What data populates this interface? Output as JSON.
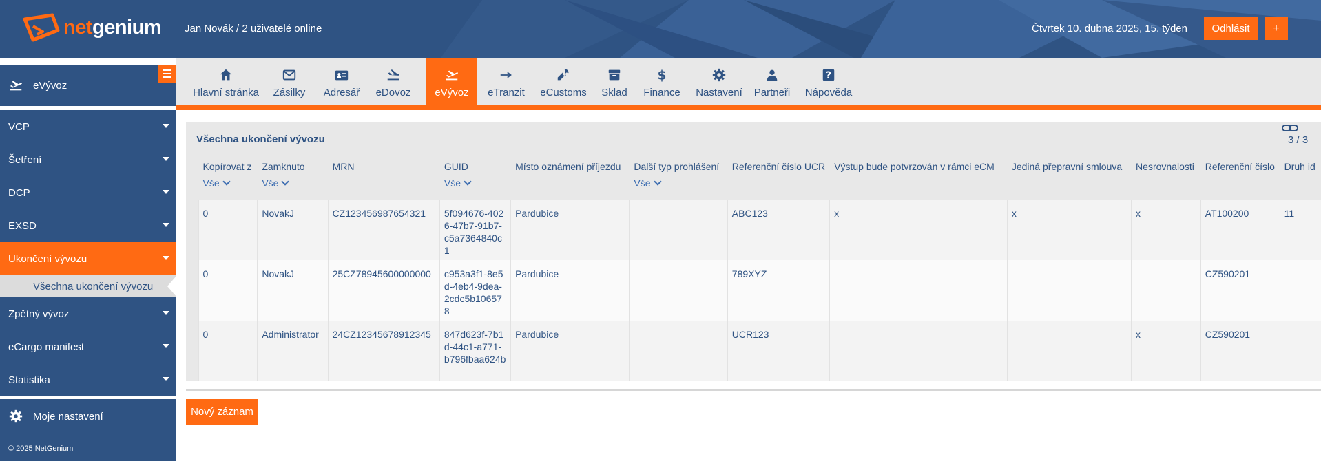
{
  "header": {
    "logo_text_a": "net",
    "logo_text_b": "genium",
    "user_info": "Jan Novák / 2 uživatelé online",
    "date_info": "Čtvrtek 10. dubna 2025, 15. týden",
    "logout_label": "Odhlásit",
    "plus_label": "+"
  },
  "nav": {
    "items": [
      {
        "label": "Hlavní stránka",
        "icon": "home-icon"
      },
      {
        "label": "Zásilky",
        "icon": "envelope-icon"
      },
      {
        "label": "Adresář",
        "icon": "id-card-icon"
      },
      {
        "label": "eDovoz",
        "icon": "plane-arrival-icon"
      },
      {
        "label": "eVývoz",
        "icon": "plane-departure-icon"
      },
      {
        "label": "eTranzit",
        "icon": "arrow-right-icon"
      },
      {
        "label": "eCustoms",
        "icon": "wrench-icon"
      },
      {
        "label": "Sklad",
        "icon": "archive-icon"
      },
      {
        "label": "Finance",
        "icon": "dollar-icon"
      },
      {
        "label": "Nastavení",
        "icon": "gear-icon"
      },
      {
        "label": "Partneři",
        "icon": "user-icon"
      },
      {
        "label": "Nápověda",
        "icon": "question-icon"
      }
    ],
    "active_index": 4
  },
  "sidebar": {
    "head_label": "eVývoz",
    "items": [
      {
        "label": "VCP"
      },
      {
        "label": "Šetření"
      },
      {
        "label": "DCP"
      },
      {
        "label": "EXSD"
      },
      {
        "label": "Ukončení vývozu"
      }
    ],
    "sub_item": "Všechna ukončení vývozu",
    "items_after": [
      {
        "label": "Zpětný vývoz"
      },
      {
        "label": "eCargo manifest"
      },
      {
        "label": "Statistika"
      }
    ],
    "settings_label": "Moje nastavení",
    "footer": "© 2025 NetGenium"
  },
  "panel": {
    "title": "Všechna ukončení vývozu",
    "count": "3 / 3"
  },
  "table": {
    "filter_label": "Vše",
    "columns": [
      {
        "label": "Kopírovat z",
        "filter": true
      },
      {
        "label": "Zamknuto",
        "filter": true
      },
      {
        "label": "MRN",
        "filter": false
      },
      {
        "label": "GUID",
        "filter": true
      },
      {
        "label": "Místo oznámení příjezdu",
        "filter": false
      },
      {
        "label": "Další typ prohlášení",
        "filter": true
      },
      {
        "label": "Referenční číslo UCR",
        "filter": false
      },
      {
        "label": "Výstup bude potvrzován v rámci eCM",
        "filter": false
      },
      {
        "label": "Jediná přepravní smlouva",
        "filter": false
      },
      {
        "label": "Nesrovnalosti",
        "filter": false
      },
      {
        "label": "Referenční číslo",
        "filter": false
      },
      {
        "label": "Druh id",
        "filter": false
      }
    ],
    "rows": [
      [
        "0",
        "NovakJ",
        "CZ123456987654321",
        "5f094676-4026-47b7-91b7-c5a7364840c1",
        "Pardubice",
        "",
        "ABC123",
        "x",
        "x",
        "x",
        "AT100200",
        "11"
      ],
      [
        "0",
        "NovakJ",
        "25CZ78945600000000",
        "c953a3f1-8e5d-4eb4-9dea-2cdc5b106578",
        "Pardubice",
        "",
        "789XYZ",
        "",
        "",
        "",
        "CZ590201",
        ""
      ],
      [
        "0",
        "Administrator",
        "24CZ12345678912345",
        "847d623f-7b1d-44c1-a771-b796fbaa624b",
        "Pardubice",
        "",
        "UCR123",
        "",
        "",
        "x",
        "CZ590201",
        ""
      ]
    ]
  },
  "new_record_label": "Nový záznam",
  "colors": {
    "primary": "#2f5383",
    "accent": "#ff6a13",
    "panel": "#e8e8e8"
  }
}
